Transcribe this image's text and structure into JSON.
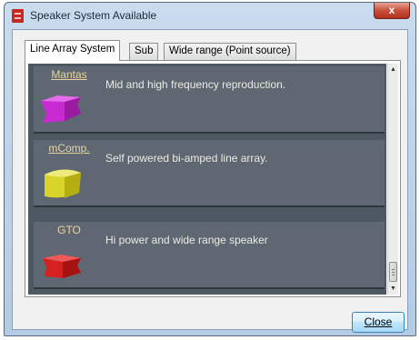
{
  "window": {
    "title": "Speaker System Available",
    "close_glyph": "x"
  },
  "tabs": [
    {
      "label": "Line Array System",
      "active": true
    },
    {
      "label": "Sub",
      "active": false
    },
    {
      "label": "Wide range (Point source)",
      "active": false
    }
  ],
  "speakers": [
    {
      "name": "Mantas",
      "description": "Mid and high frequency reproduction.",
      "color": "#c72ad0",
      "icon": "magenta-speaker-icon"
    },
    {
      "name": "mComp.",
      "description": "Self powered bi-amped line array.",
      "color": "#d9d42a",
      "icon": "yellow-speaker-icon"
    },
    {
      "name": "GTO",
      "description": "Hi power and wide range speaker",
      "color": "#d42222",
      "icon": "red-speaker-icon"
    }
  ],
  "scrollbar": {
    "up_glyph": "▲",
    "down_glyph": "▼"
  },
  "footer": {
    "close_label": "Close"
  }
}
